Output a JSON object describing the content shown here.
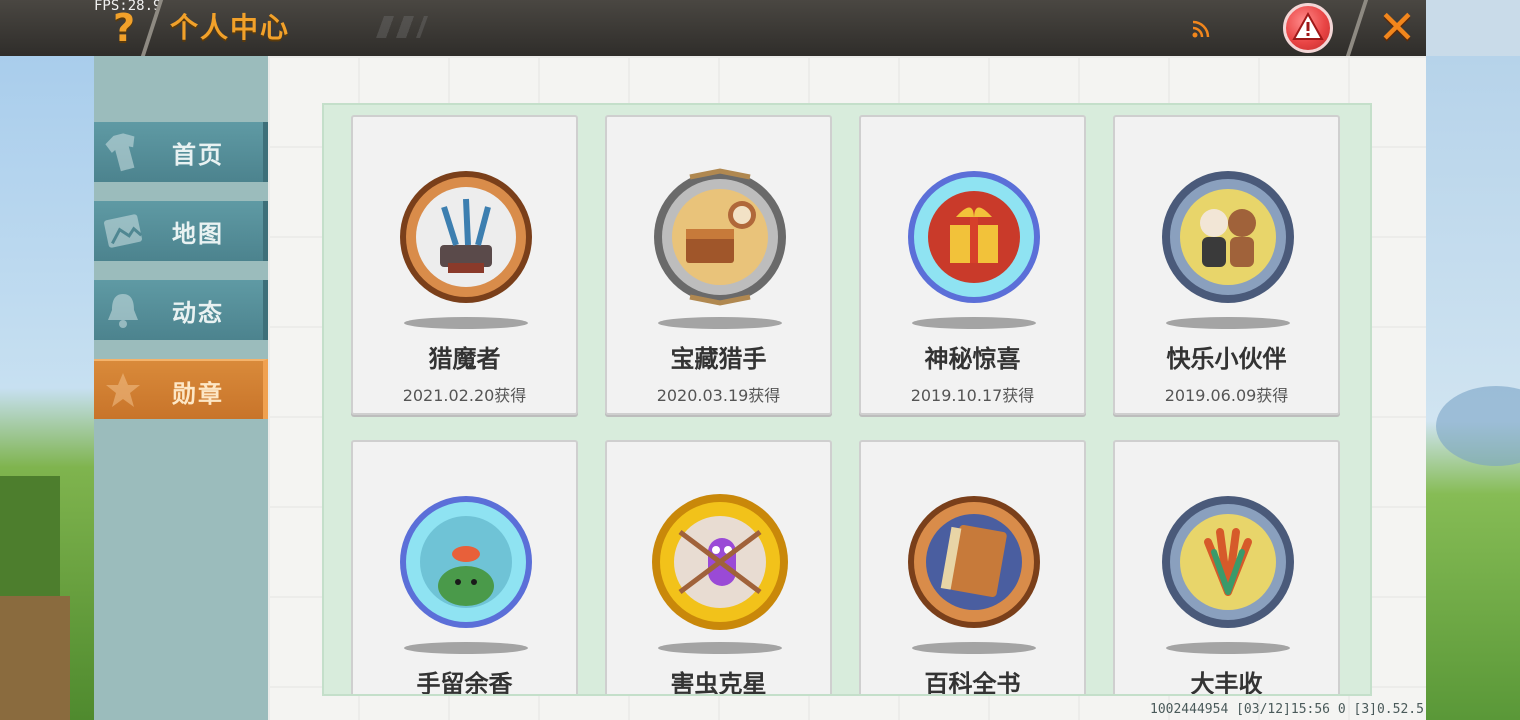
{
  "header": {
    "fps": "FPS:28.9",
    "help_symbol": "?",
    "title": "个人中心",
    "close_symbol": "✕"
  },
  "sidebar": {
    "items": [
      {
        "label": "首页",
        "icon": "shirt-icon",
        "active": false
      },
      {
        "label": "地图",
        "icon": "map-picture-icon",
        "active": false
      },
      {
        "label": "动态",
        "icon": "bell-icon",
        "active": false
      },
      {
        "label": "勋章",
        "icon": "medal-icon",
        "active": true
      }
    ]
  },
  "badges": [
    {
      "name": "猎魔者",
      "date": "2021.02.20获得",
      "rim": "bronze",
      "center": "#c9773a",
      "icon": "swords-anvil-icon"
    },
    {
      "name": "宝藏猎手",
      "date": "2020.03.19获得",
      "rim": "stone",
      "center": "#e9c37a",
      "icon": "treasure-chest-icon"
    },
    {
      "name": "神秘惊喜",
      "date": "2019.10.17获得",
      "rim": "diamond",
      "center": "#c93a2a",
      "icon": "gift-box-icon"
    },
    {
      "name": "快乐小伙伴",
      "date": "2019.06.09获得",
      "rim": "steel",
      "center": "#e8d56a",
      "icon": "friends-icon"
    },
    {
      "name": "手留余香",
      "date": "",
      "rim": "diamond",
      "center": "#6fc3d6",
      "icon": "frog-flower-icon"
    },
    {
      "name": "害虫克星",
      "date": "",
      "rim": "gold",
      "center": "#b98ac9",
      "icon": "bug-icon"
    },
    {
      "name": "百科全书",
      "date": "",
      "rim": "bronze",
      "center": "#4a5ea0",
      "icon": "book-icon"
    },
    {
      "name": "大丰收",
      "date": "",
      "rim": "steel",
      "center": "#e8d56a",
      "icon": "harvest-leaves-icon"
    }
  ],
  "footer": {
    "info": "1002444954   [03/12]15:56 0  [3]0.52.5"
  },
  "colors": {
    "accent_orange": "#f2a12a",
    "nav_teal": "#4c838e",
    "nav_active": "#c8742a",
    "grid_bg": "#d8ecdc"
  }
}
